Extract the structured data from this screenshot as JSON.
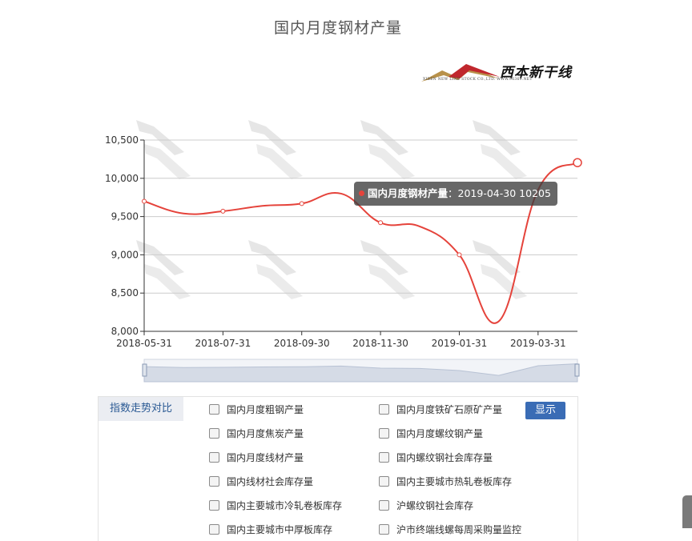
{
  "page": {
    "title": "国内月度钢材产量"
  },
  "logo": {
    "text": "西本新干线",
    "subtext": "XIBEN NEW LINE STOCK CO.,LTD.   WWW.96369.NET"
  },
  "colors": {
    "series": "#e5433b",
    "axis": "#333333",
    "grid": "#cccccc",
    "button": "#3a6cb5",
    "zoom_fill": "#d5dbe6"
  },
  "chart_data": {
    "type": "line",
    "title": "国内月度钢材产量",
    "x": [
      "2018-05-31",
      "2018-06-30",
      "2018-07-31",
      "2018-08-31",
      "2018-09-30",
      "2018-10-31",
      "2018-11-30",
      "2018-12-31",
      "2019-01-31",
      "2019-02-28",
      "2019-03-31",
      "2019-04-30"
    ],
    "x_tick_labels": [
      "2018-05-31",
      "2018-07-31",
      "2018-09-30",
      "2018-11-30",
      "2019-01-31",
      "2019-03-31"
    ],
    "series": [
      {
        "name": "国内月度钢材产量",
        "values": [
          9700,
          9540,
          9570,
          9640,
          9670,
          9800,
          9420,
          9370,
          9000,
          8130,
          9850,
          10205
        ]
      }
    ],
    "ylim": [
      8000,
      10500
    ],
    "y_ticks": [
      8000,
      8500,
      9000,
      9500,
      10000,
      10500
    ],
    "y_tick_labels": [
      "8,000",
      "8,500",
      "9,000",
      "9,500",
      "10,000",
      "10,500"
    ],
    "xlabel": "",
    "ylabel": "",
    "grid": true,
    "markers_at": [
      0,
      2,
      4,
      6,
      8,
      11
    ],
    "tooltip": {
      "series_name": "国内月度钢材产量",
      "separator": "：",
      "date": "2019-04-30",
      "value": "10205"
    }
  },
  "compare_panel": {
    "label": "指数走势对比",
    "button_label": "显示",
    "options": [
      "国内月度粗钢产量",
      "国内月度铁矿石原矿产量",
      "国内月度焦炭产量",
      "国内月度螺纹钢产量",
      "国内月度线材产量",
      "国内螺纹钢社会库存量",
      "国内线材社会库存量",
      "国内主要城市热轧卷板库存",
      "国内主要城市冷轧卷板库存",
      "沪螺纹钢社会库存",
      "国内主要城市中厚板库存",
      "沪市终端线螺每周采购量监控"
    ]
  }
}
